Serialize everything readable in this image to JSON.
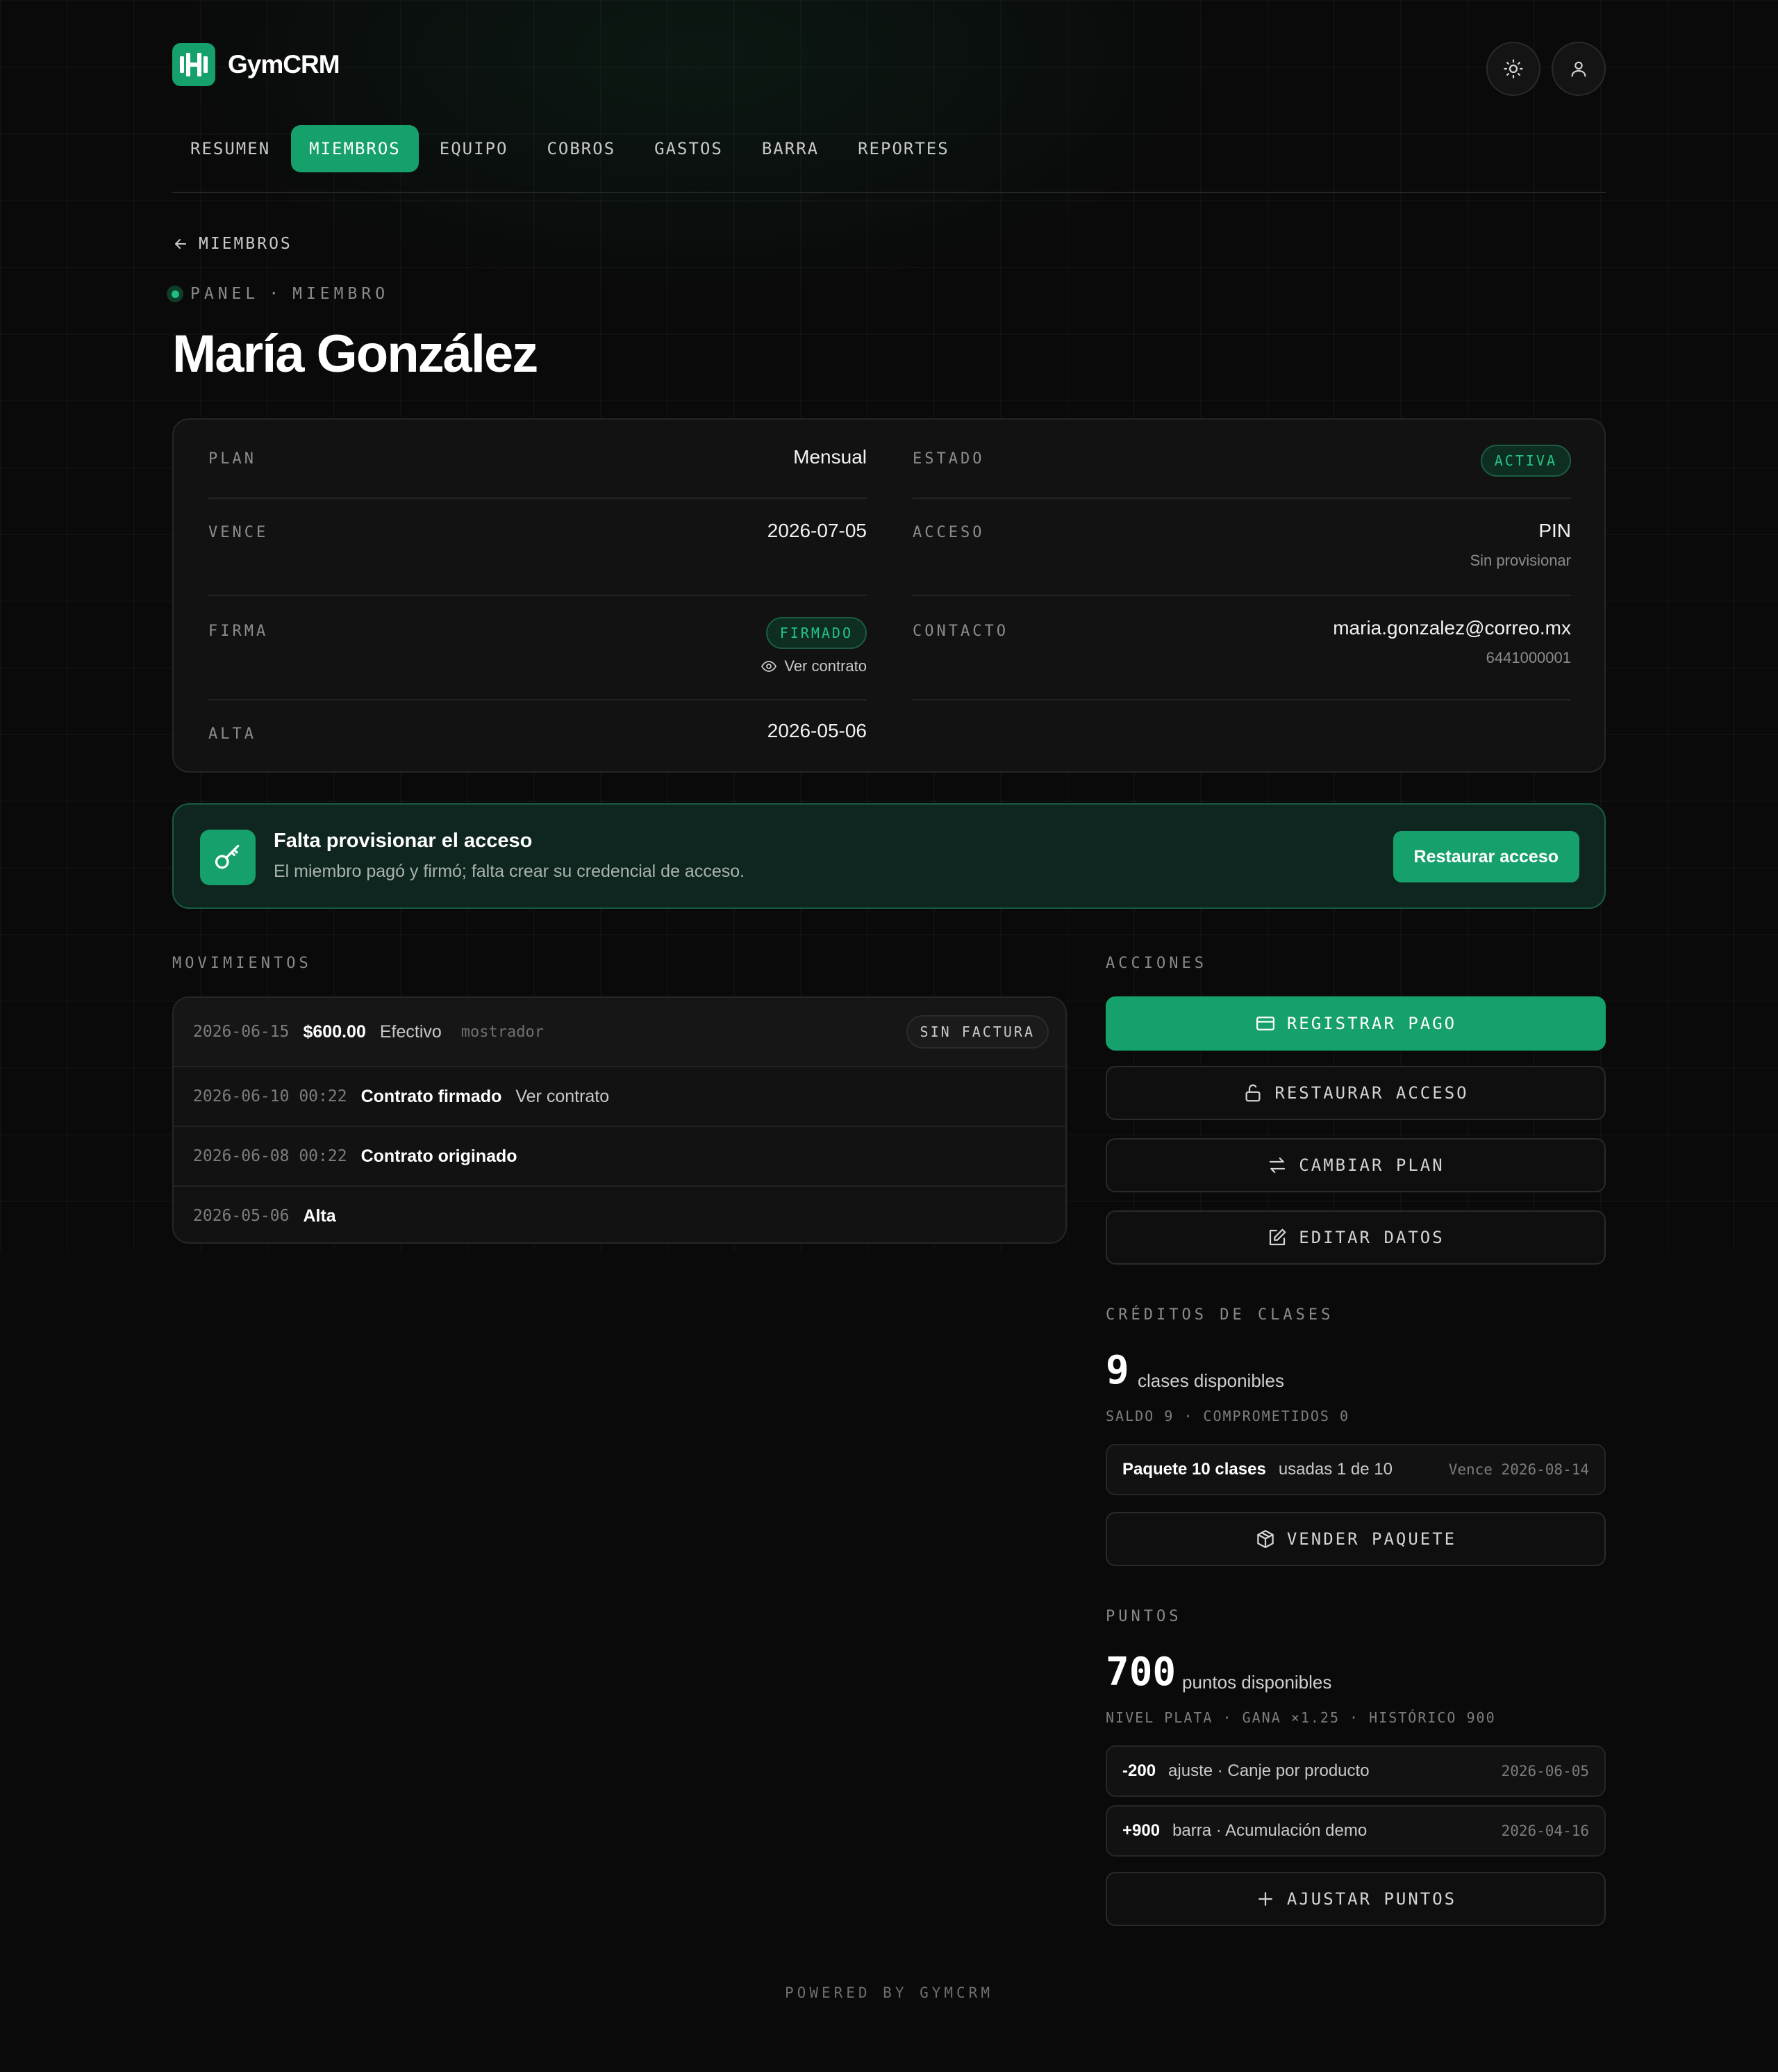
{
  "app": {
    "name": "GymCRM"
  },
  "icons": {
    "logo": "dumbbell-logo",
    "theme": "sun-icon",
    "user": "user-icon",
    "back": "arrow-left-icon",
    "alert": "key-icon"
  },
  "colors": {
    "accent": "#16a06b",
    "background": "#0a0a0a",
    "success_text": "#25c483"
  },
  "nav": [
    "RESUMEN",
    "MIEMBROS",
    "EQUIPO",
    "COBROS",
    "GASTOS",
    "BARRA",
    "REPORTES"
  ],
  "nav_active": "MIEMBROS",
  "back_label": "MIEMBROS",
  "eyebrow": {
    "a": "PANEL",
    "sep": "·",
    "b": "MIEMBRO"
  },
  "member": {
    "name": "María González"
  },
  "info": {
    "plan": {
      "label": "PLAN",
      "value": "Mensual"
    },
    "estado": {
      "label": "ESTADO",
      "value": "ACTIVA"
    },
    "vence": {
      "label": "VENCE",
      "value": "2026-07-05"
    },
    "acceso": {
      "label": "ACCESO",
      "value": "PIN",
      "sub": "Sin provisionar"
    },
    "firma": {
      "label": "FIRMA",
      "value": "FIRMADO",
      "link": "Ver contrato"
    },
    "contacto": {
      "label": "CONTACTO",
      "email": "maria.gonzalez@correo.mx",
      "phone": "6441000001"
    },
    "alta": {
      "label": "ALTA",
      "value": "2026-05-06"
    }
  },
  "alert": {
    "title": "Falta provisionar el acceso",
    "text": "El miembro pagó y firmó; falta crear su credencial de acceso.",
    "button": "Restaurar acceso"
  },
  "movements": {
    "title": "MOVIMIENTOS",
    "rows": [
      {
        "date": "2026-06-15",
        "amount": "$600.00",
        "method": "Efectivo",
        "where": "mostrador",
        "tag": "SIN FACTURA"
      },
      {
        "date": "2026-06-10 00:22",
        "event": "Contrato firmado",
        "link": "Ver contrato"
      },
      {
        "date": "2026-06-08 00:22",
        "event": "Contrato originado"
      },
      {
        "date": "2026-05-06",
        "event": "Alta"
      }
    ]
  },
  "actions": {
    "title": "ACCIONES",
    "buttons": [
      "REGISTRAR PAGO",
      "RESTAURAR ACCESO",
      "CAMBIAR PLAN",
      "EDITAR DATOS"
    ]
  },
  "credits": {
    "title": "CRÉDITOS DE CLASES",
    "count": "9",
    "label": "clases disponibles",
    "meta": "SALDO 9 · COMPROMETIDOS 0",
    "package": {
      "name": "Paquete 10 clases",
      "usage": "usadas 1 de 10",
      "expires": "Vence 2026-08-14"
    },
    "button": "VENDER PAQUETE"
  },
  "points": {
    "title": "PUNTOS",
    "count": "700",
    "label": "puntos disponibles",
    "meta": "NIVEL PLATA · GANA ×1.25 · HISTÓRICO 900",
    "entries": [
      {
        "delta": "-200",
        "desc": "ajuste · Canje por producto",
        "date": "2026-06-05"
      },
      {
        "delta": "+900",
        "desc": "barra · Acumulación demo",
        "date": "2026-04-16"
      }
    ],
    "button": "AJUSTAR PUNTOS"
  },
  "footer": "POWERED BY GYMCRM"
}
